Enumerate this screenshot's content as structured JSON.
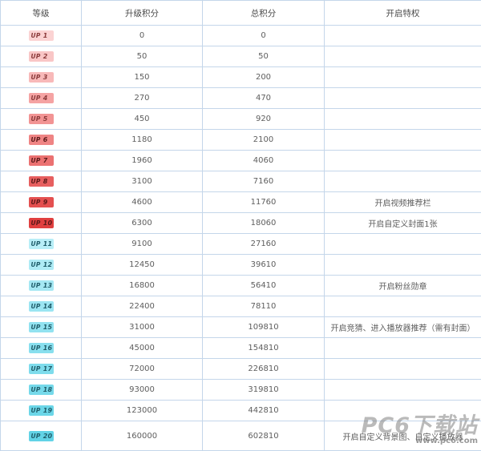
{
  "headers": [
    "等级",
    "升级积分",
    "总积分",
    "开启特权"
  ],
  "badge_prefix": "UP",
  "colors": {
    "border": "#c4d6ea",
    "red_levels": [
      "#fbd3d3",
      "#f9c6c6",
      "#f8b9b9",
      "#f5a3a3",
      "#f29494",
      "#ef8484",
      "#eb7171",
      "#e75f5f",
      "#e45050",
      "#e04040"
    ],
    "cyan_levels": [
      "#b8eef7",
      "#aeebf5",
      "#a5e8f3",
      "#9be5f2",
      "#91e2f0",
      "#88dfee",
      "#7edcec",
      "#75d9ea",
      "#6bd6e8",
      "#62d3e6"
    ]
  },
  "rows": [
    {
      "level": "1",
      "upgrade": "0",
      "total": "0",
      "perk": ""
    },
    {
      "level": "2",
      "upgrade": "50",
      "total": "50",
      "perk": ""
    },
    {
      "level": "3",
      "upgrade": "150",
      "total": "200",
      "perk": ""
    },
    {
      "level": "4",
      "upgrade": "270",
      "total": "470",
      "perk": ""
    },
    {
      "level": "5",
      "upgrade": "450",
      "total": "920",
      "perk": ""
    },
    {
      "level": "6",
      "upgrade": "1180",
      "total": "2100",
      "perk": ""
    },
    {
      "level": "7",
      "upgrade": "1960",
      "total": "4060",
      "perk": ""
    },
    {
      "level": "8",
      "upgrade": "3100",
      "total": "7160",
      "perk": ""
    },
    {
      "level": "9",
      "upgrade": "4600",
      "total": "11760",
      "perk": "开启视频推荐栏"
    },
    {
      "level": "10",
      "upgrade": "6300",
      "total": "18060",
      "perk": "开启自定义封面1张"
    },
    {
      "level": "11",
      "upgrade": "9100",
      "total": "27160",
      "perk": ""
    },
    {
      "level": "12",
      "upgrade": "12450",
      "total": "39610",
      "perk": ""
    },
    {
      "level": "13",
      "upgrade": "16800",
      "total": "56410",
      "perk": "开启粉丝勋章"
    },
    {
      "level": "14",
      "upgrade": "22400",
      "total": "78110",
      "perk": ""
    },
    {
      "level": "15",
      "upgrade": "31000",
      "total": "109810",
      "perk": "开启竞猜、进入播放器推荐（需有封面）"
    },
    {
      "level": "16",
      "upgrade": "45000",
      "total": "154810",
      "perk": ""
    },
    {
      "level": "17",
      "upgrade": "72000",
      "total": "226810",
      "perk": ""
    },
    {
      "level": "18",
      "upgrade": "93000",
      "total": "319810",
      "perk": ""
    },
    {
      "level": "19",
      "upgrade": "123000",
      "total": "442810",
      "perk": ""
    },
    {
      "level": "20",
      "upgrade": "160000",
      "total": "602810",
      "perk": "开启自定义背景图、自定义播放器"
    }
  ],
  "watermark": {
    "brand": "PC6下载站",
    "url": "www.pc6.com"
  }
}
